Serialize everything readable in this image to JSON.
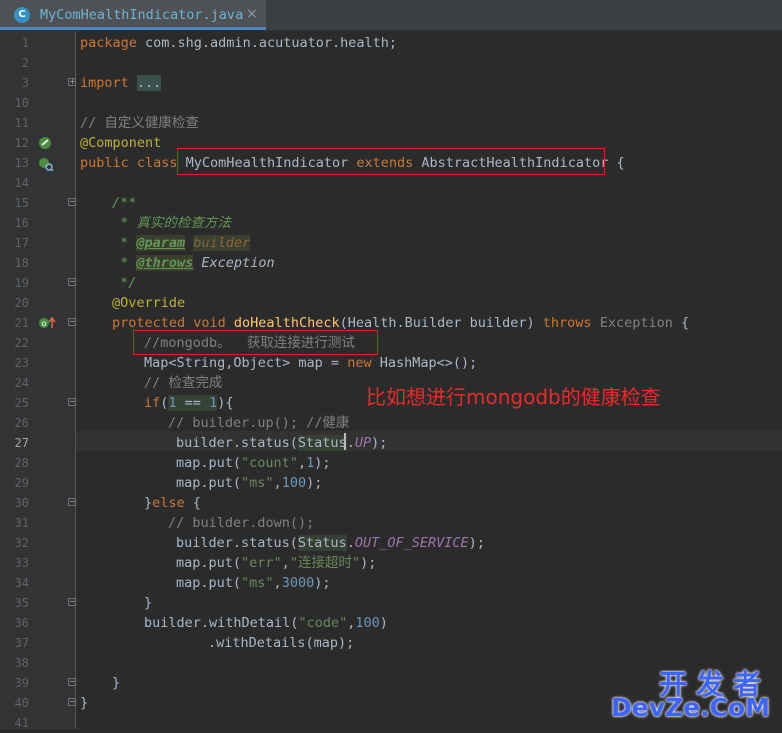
{
  "tab": {
    "title": "MyComHealthIndicator.java",
    "close": "×",
    "file_icon": "C"
  },
  "lines": [
    {
      "n": "1"
    },
    {
      "n": "2"
    },
    {
      "n": "3"
    },
    {
      "n": "10"
    },
    {
      "n": "11"
    },
    {
      "n": "12"
    },
    {
      "n": "13"
    },
    {
      "n": "14"
    },
    {
      "n": "15"
    },
    {
      "n": "16"
    },
    {
      "n": "17"
    },
    {
      "n": "18"
    },
    {
      "n": "19"
    },
    {
      "n": "20"
    },
    {
      "n": "21"
    },
    {
      "n": "22"
    },
    {
      "n": "23"
    },
    {
      "n": "24"
    },
    {
      "n": "25"
    },
    {
      "n": "26"
    },
    {
      "n": "27"
    },
    {
      "n": "28"
    },
    {
      "n": "29"
    },
    {
      "n": "30"
    },
    {
      "n": "31"
    },
    {
      "n": "32"
    },
    {
      "n": "33"
    },
    {
      "n": "34"
    },
    {
      "n": "35"
    },
    {
      "n": "36"
    },
    {
      "n": "37"
    },
    {
      "n": "38"
    },
    {
      "n": "39"
    },
    {
      "n": "40"
    },
    {
      "n": "41"
    }
  ],
  "code": {
    "l1a": "package ",
    "l1b": "com.shg.admin.acutuator.health;",
    "l3a": "import ",
    "l3b": "...",
    "l11": "// 自定义健康检查",
    "l12": "@Component",
    "l13a": "public class ",
    "l13b": "MyComHealthIndicator ",
    "l13c": "extends ",
    "l13d": "AbstractHealthIndicator",
    "l13e": " {",
    "l15": "/**",
    "l16": " * 真实的检查方法",
    "l17a": " * ",
    "l17b": "@param",
    "l17c": " ",
    "l17d": "builder",
    "l18a": " * ",
    "l18b": "@throws",
    "l18c": " Exception",
    "l19": " */",
    "l20": "@Override",
    "l21a": "protected void ",
    "l21b": "doHealthCheck",
    "l21c": "(Health.Builder builder) ",
    "l21d": "throws ",
    "l21e": "Exception",
    "l21f": " {",
    "l22": "//mongodb。  获取连接进行测试",
    "l23a": "Map<String,Object> map = ",
    "l23b": "new ",
    "l23c": "HashMap<>();",
    "l24": "// 检查完成",
    "l25a": "if",
    "l25b": "(",
    "l25c": "1",
    "l25d": " == ",
    "l25e": "1",
    "l25f": "){",
    "l26": "// builder.up(); //健康",
    "l27a": "builder.status(",
    "l27b": "Status",
    "l27c": ".",
    "l27d": "UP",
    "l27e": ");",
    "l28a": "map.put(",
    "l28b": "\"count\"",
    "l28c": ",",
    "l28d": "1",
    "l28e": ");",
    "l29a": "map.put(",
    "l29b": "\"ms\"",
    "l29c": ",",
    "l29d": "100",
    "l29e": ");",
    "l30a": "}",
    "l30b": "else",
    "l30c": " {",
    "l31": "// builder.down();",
    "l32a": "builder.status(",
    "l32b": "Status",
    "l32c": ".",
    "l32d": "OUT_OF_SERVICE",
    "l32e": ");",
    "l33a": "map.put(",
    "l33b": "\"err\"",
    "l33c": ",",
    "l33d": "\"连接超时\"",
    "l33e": ");",
    "l34a": "map.put(",
    "l34b": "\"ms\"",
    "l34c": ",",
    "l34d": "3000",
    "l34e": ");",
    "l35": "}",
    "l36a": "builder.withDetail(",
    "l36b": "\"code\"",
    "l36c": ",",
    "l36d": "100",
    "l36e": ")",
    "l37": ".withDetails(map);",
    "l39": "}",
    "l40": "}"
  },
  "annotation": "比如想进行mongodb的健康检查",
  "watermark": {
    "top": "开发者",
    "bottom": "DevZe.CoM"
  },
  "colors": {
    "keyword": "#cc7832",
    "string": "#6a8759",
    "number": "#6897bb",
    "comment": "#808080",
    "doc": "#629755",
    "annotation": "#bbb529",
    "method": "#ffc66d",
    "highlight_box": "#e02020"
  }
}
